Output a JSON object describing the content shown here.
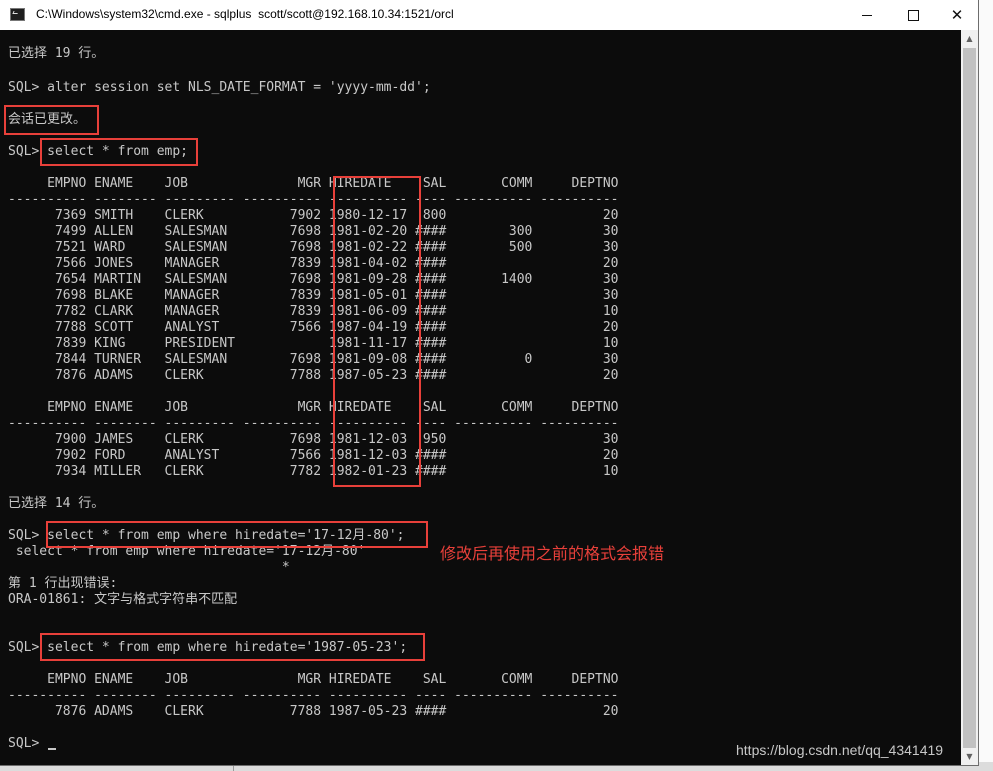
{
  "window": {
    "title": "C:\\Windows\\system32\\cmd.exe - sqlplus  scott/scott@192.168.10.34:1521/orcl",
    "icon": "cmd-icon",
    "controls": {
      "minimize": "minimize-icon",
      "maximize": "maximize-icon",
      "close_label": "✕"
    }
  },
  "colors": {
    "console_bg": "#0c0c0c",
    "console_text": "#c8c8c8",
    "highlight": "#e8403a"
  },
  "console": {
    "selected_19": "已选择 19 行。",
    "alter_cmd": "SQL> alter session set NLS_DATE_FORMAT = 'yyyy-mm-dd';",
    "session_changed": "会话已更改。",
    "select_cmd": "SQL> select * from emp;",
    "header": "     EMPNO ENAME    JOB              MGR HIREDATE    SAL       COMM     DEPTNO",
    "divider": "---------- -------- --------- ---------- ---------- ---- ---------- ----------",
    "rows_block1": [
      "      7369 SMITH    CLERK           7902 1980-12-17  800                    20",
      "      7499 ALLEN    SALESMAN        7698 1981-02-20 ####        300         30",
      "      7521 WARD     SALESMAN        7698 1981-02-22 ####        500         30",
      "      7566 JONES    MANAGER         7839 1981-04-02 ####                    20",
      "      7654 MARTIN   SALESMAN        7698 1981-09-28 ####       1400         30",
      "      7698 BLAKE    MANAGER         7839 1981-05-01 ####                    30",
      "      7782 CLARK    MANAGER         7839 1981-06-09 ####                    10",
      "      7788 SCOTT    ANALYST         7566 1987-04-19 ####                    20",
      "      7839 KING     PRESIDENT            1981-11-17 ####                    10",
      "      7844 TURNER   SALESMAN        7698 1981-09-08 ####          0         30",
      "      7876 ADAMS    CLERK           7788 1987-05-23 ####                    20"
    ],
    "rows_block2": [
      "      7900 JAMES    CLERK           7698 1981-12-03  950                    30",
      "      7902 FORD     ANALYST         7566 1981-12-03 ####                    20",
      "      7934 MILLER   CLERK           7782 1982-01-23 ####                    10"
    ],
    "selected_14": "已选择 14 行。",
    "where_cmd_1": "SQL> select * from emp where hiredate='17-12月-80';",
    "echo_1": " select * from emp where hiredate='17-12月-80'",
    "caret": "                                   *",
    "error_line": "第 1 行出现错误:",
    "error_msg": "ORA-01861: 文字与格式字符串不匹配",
    "where_cmd_2": "SQL> select * from emp where hiredate='1987-05-23';",
    "rows_block3": [
      "      7876 ADAMS    CLERK           7788 1987-05-23 ####                    20"
    ],
    "prompt": "SQL> "
  },
  "annotation": "修改后再使用之前的格式会报错",
  "watermark": "https://blog.csdn.net/qq_4341419"
}
